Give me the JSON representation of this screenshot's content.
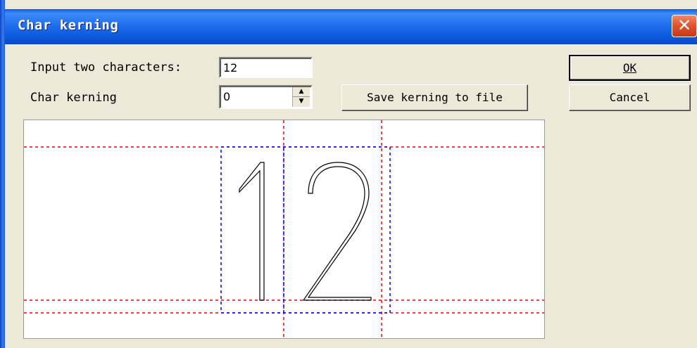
{
  "window": {
    "title": "Char kerning",
    "close_glyph": "✕"
  },
  "form": {
    "input_label": "Input two characters:",
    "input_value": "12",
    "kerning_label": "Char kerning",
    "kerning_value": "0",
    "spin_up": "▲",
    "spin_down": "▼"
  },
  "buttons": {
    "save": "Save kerning to file",
    "ok": "OK",
    "cancel": "Cancel"
  },
  "preview": {
    "guide_color_red": "#ff0000",
    "guide_color_blue": "#0000ff",
    "glyph_color": "#000000"
  }
}
